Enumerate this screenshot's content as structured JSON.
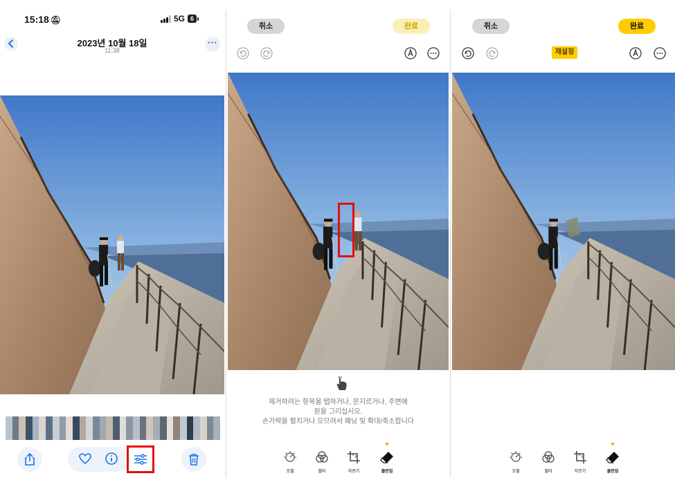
{
  "panel1": {
    "status_bar": {
      "time": "15:18",
      "network": "5G",
      "battery": "6"
    },
    "header": {
      "date": "2023년 10월 18일",
      "time": "11:38"
    },
    "thumbnail_colors": [
      "#b9c4cf",
      "#6f7a83",
      "#c9c1b5",
      "#3f5168",
      "#a9b5c2",
      "#dad5cf",
      "#5d6f86",
      "#c7cdd3",
      "#8f9ba6",
      "#e2dbd2",
      "#394a5f",
      "#b3a89b",
      "#d0d6dc",
      "#7a8895",
      "#9fa8b1",
      "#c4b9ad",
      "#4e5d6f",
      "#dcdcdc",
      "#8a96a3",
      "#b8bfc7",
      "#6a737d",
      "#cfc5ba",
      "#a3adb7",
      "#5b6775",
      "#e5e0da",
      "#90857a",
      "#c0c8d0",
      "#2f3c4b",
      "#b2bac3",
      "#d8d2cb",
      "#7d8893",
      "#a7b0b9"
    ],
    "toolbar": [
      "share-icon",
      "heart-icon",
      "info-icon",
      "edit-sliders-icon",
      "trash-icon"
    ]
  },
  "panel2": {
    "cancel_label": "취소",
    "done_label": "완료",
    "instruction_lines": [
      "제거하려는 항목을 탭하거나, 문지르거나, 주변에",
      "원을 그리십시오.",
      "손가락을 펼치거나 오므려서 패닝 및 확대/축소합니다"
    ],
    "tools": [
      {
        "label": "조절",
        "icon": "adjust-dial-icon"
      },
      {
        "label": "필터",
        "icon": "filter-icon"
      },
      {
        "label": "자르기",
        "icon": "crop-icon"
      },
      {
        "label": "클린업",
        "icon": "eraser-icon"
      }
    ]
  },
  "panel3": {
    "cancel_label": "취소",
    "done_label": "완료",
    "reset_label": "재설정",
    "tools": [
      {
        "label": "조절",
        "icon": "adjust-dial-icon"
      },
      {
        "label": "필터",
        "icon": "filter-icon"
      },
      {
        "label": "자르기",
        "icon": "crop-icon"
      },
      {
        "label": "클린업",
        "icon": "eraser-icon"
      }
    ]
  },
  "colors": {
    "accent_yellow": "#ffcc00",
    "highlight_red": "#e01010",
    "ios_blue": "#1a73e8"
  }
}
